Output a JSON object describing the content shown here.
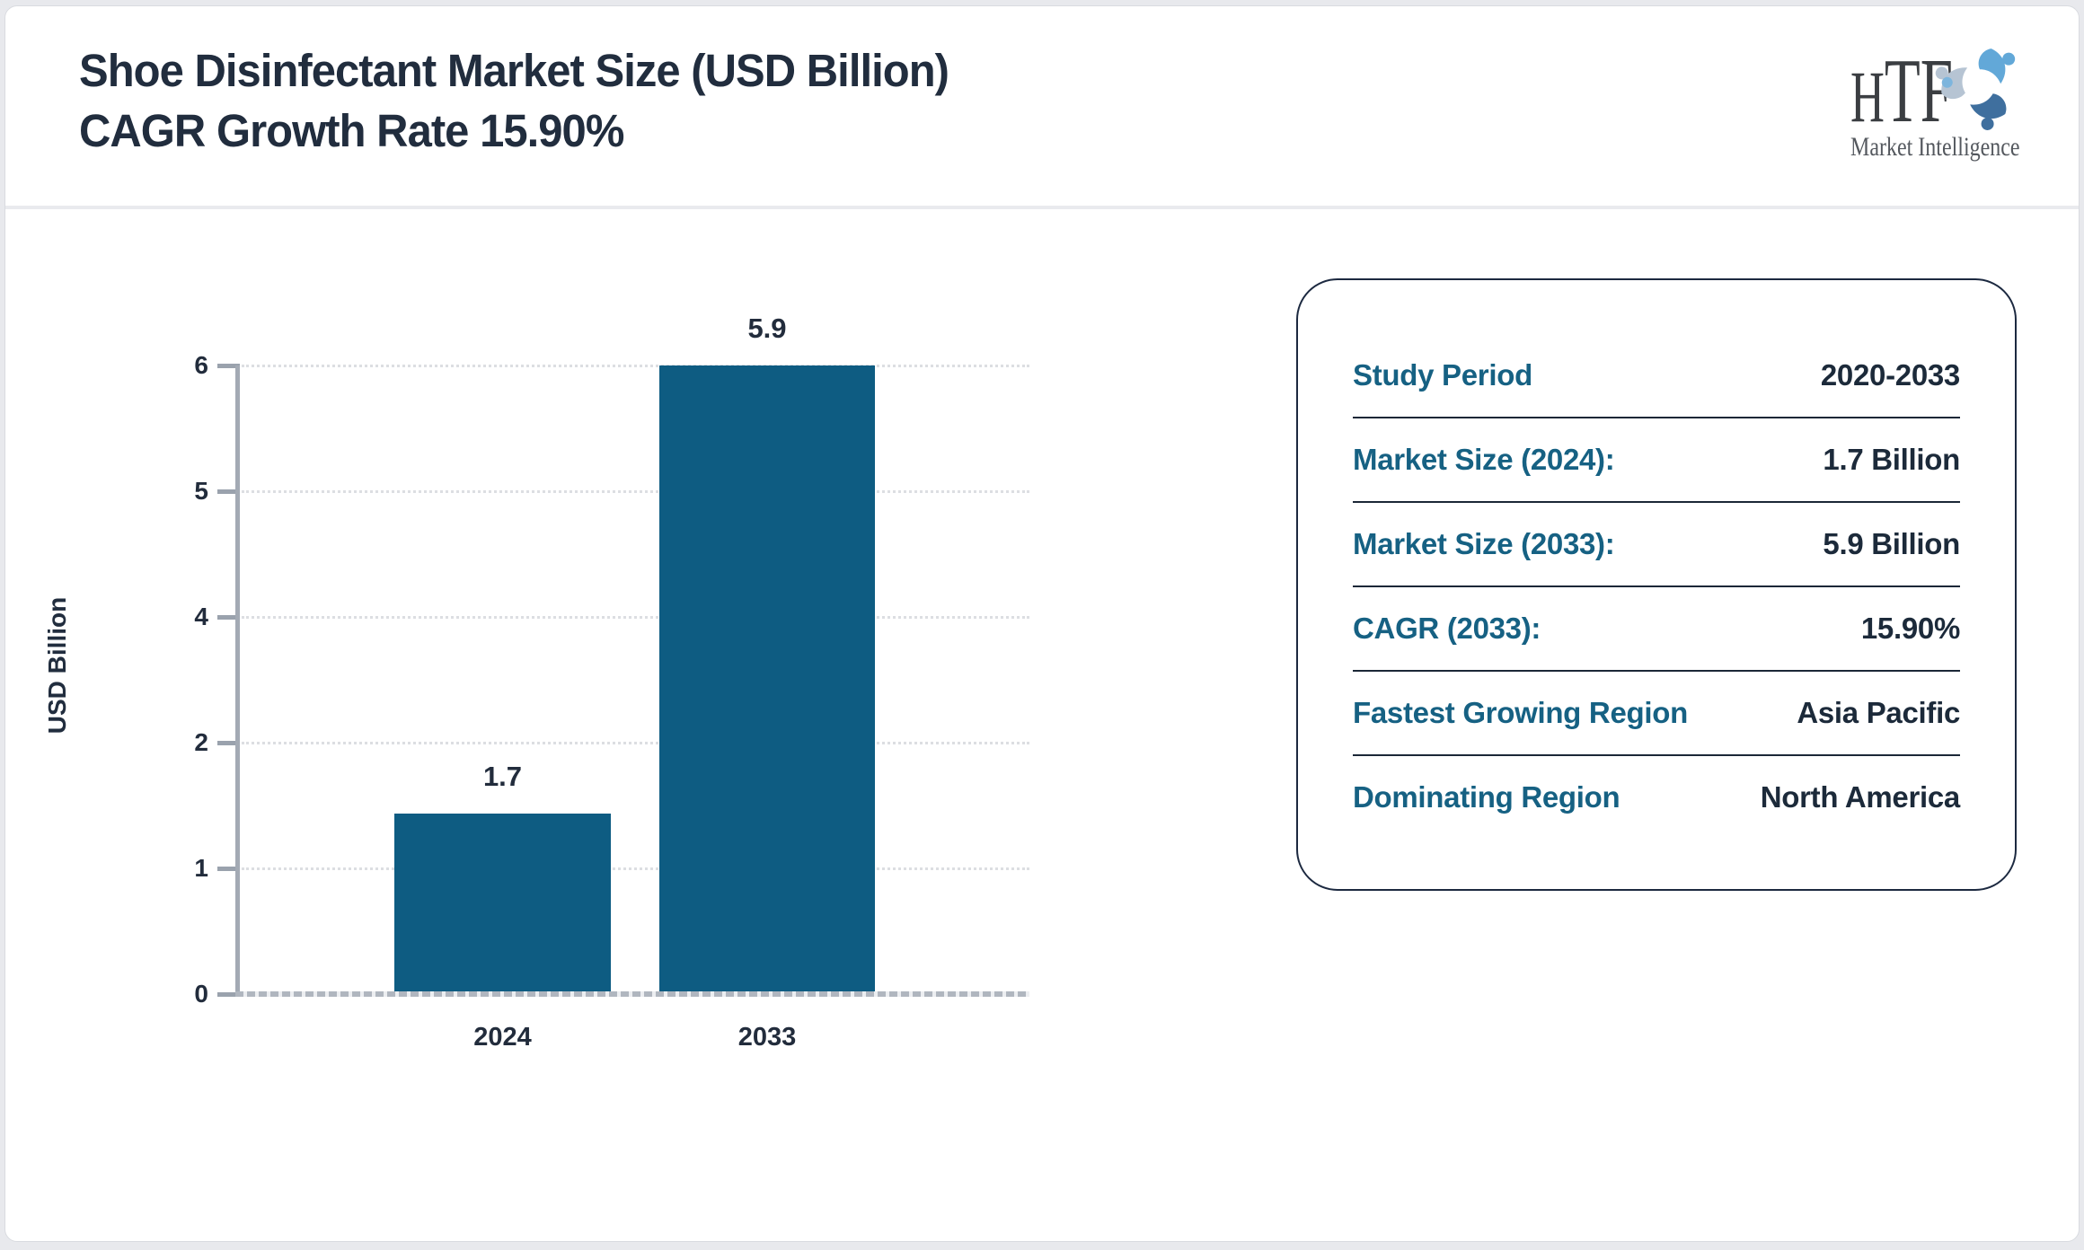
{
  "header": {
    "title_line1": "Shoe Disinfectant Market Size (USD Billion)",
    "title_line2": "CAGR Growth Rate 15.90%"
  },
  "logo": {
    "h": "H",
    "tf": "TF",
    "tagline": "Market Intelligence"
  },
  "chart_data": {
    "type": "bar",
    "title": "Shoe Disinfectant Market Size (USD Billion) CAGR Growth Rate 15.90%",
    "categories": [
      "2024",
      "2033"
    ],
    "values": [
      1.7,
      5.9
    ],
    "ylabel": "USD Billion",
    "xlabel": "",
    "ylim": [
      0,
      6
    ],
    "y_ticks": [
      "6",
      "5",
      "4",
      "2",
      "1",
      "0"
    ],
    "grid": "horizontal dotted",
    "legend": "none",
    "bar_color": "#0e5c82"
  },
  "info_panel": {
    "rows": [
      {
        "label": "Study Period",
        "value": "2020-2033"
      },
      {
        "label": "Market Size (2024):",
        "value": "1.7 Billion"
      },
      {
        "label": "Market Size (2033):",
        "value": "5.9 Billion"
      },
      {
        "label": "CAGR (2033):",
        "value": "15.90%"
      },
      {
        "label": "Fastest Growing Region",
        "value": "Asia Pacific"
      },
      {
        "label": "Dominating Region",
        "value": "North America"
      }
    ]
  },
  "colors": {
    "bar": "#0e5c82",
    "panel_label": "#166183",
    "dark_text": "#212d3e",
    "axis": "#a3aab4",
    "gridline": "#dcdee2",
    "page_background": "#e8e9ed",
    "logo_blue_light": "#62a8d8",
    "logo_blue_dark": "#3f6f9e",
    "logo_gray_blue": "#b6c4d3"
  }
}
